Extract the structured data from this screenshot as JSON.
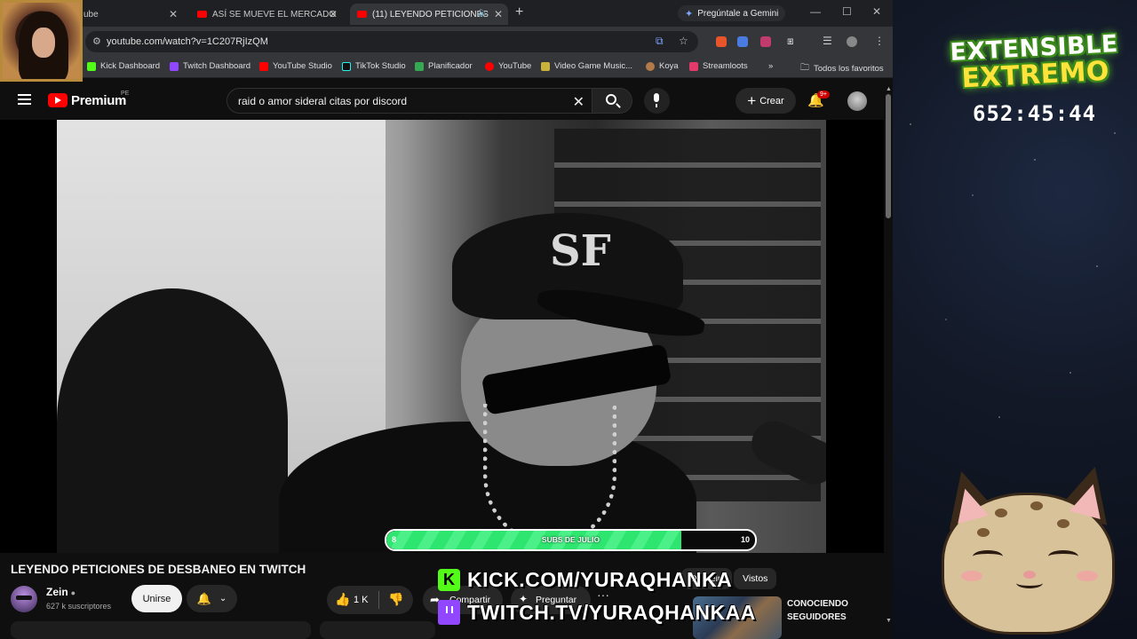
{
  "browser": {
    "tabs": [
      {
        "title": "ube",
        "muted": false
      },
      {
        "title": "ASÍ SE MUEVE EL MERCADO",
        "muted": false
      },
      {
        "title": "(11) LEYENDO PETICIONES",
        "muted": true
      }
    ],
    "gemini_button": "Pregúntale a Gemini",
    "url": "youtube.com/watch?v=1C207RjIzQM",
    "bookmarks": [
      "Kick Dashboard",
      "Twitch Dashboard",
      "YouTube Studio",
      "TikTok Studio",
      "Planificador",
      "YouTube",
      "Video Game Music...",
      "Koya",
      "Streamloots"
    ],
    "more_bookmarks": "»",
    "all_favorites": "Todos los favoritos"
  },
  "youtube": {
    "brand": "Premium",
    "country": "PE",
    "search_query": "raid o amor sideral citas por discord",
    "create_label": "Crear",
    "notifications_badge": "9+",
    "video_title": "LEYENDO PETICIONES DE DESBANEO EN TWITCH",
    "channel_name": "Zein",
    "subscribers": "627 k suscriptores",
    "join_label": "Unirse",
    "like_count": "1 K",
    "share_label": "Compartir",
    "ask_label": "Preguntar",
    "chips": [
      "De Zein",
      "Vistos"
    ],
    "suggestion_title": "CONOCIENDO SEGUIDORES"
  },
  "subs_goal": {
    "label": "SUBS DE JULIO",
    "current": "8",
    "target": "10",
    "fill_fraction": 0.8
  },
  "overlay": {
    "kick_url": "KICK.COM/YURAQHANKA",
    "twitch_url": "TWITCH.TV/YURAQHANKAA",
    "event_line1": "EXTENSIBLE",
    "event_line2": "EXTREMO",
    "timer": "652:45:44"
  },
  "colors": {
    "youtube_red": "#ff0000",
    "kick_green": "#53fc18",
    "twitch_purple": "#9146ff",
    "goal_green": "#2ee66f"
  }
}
